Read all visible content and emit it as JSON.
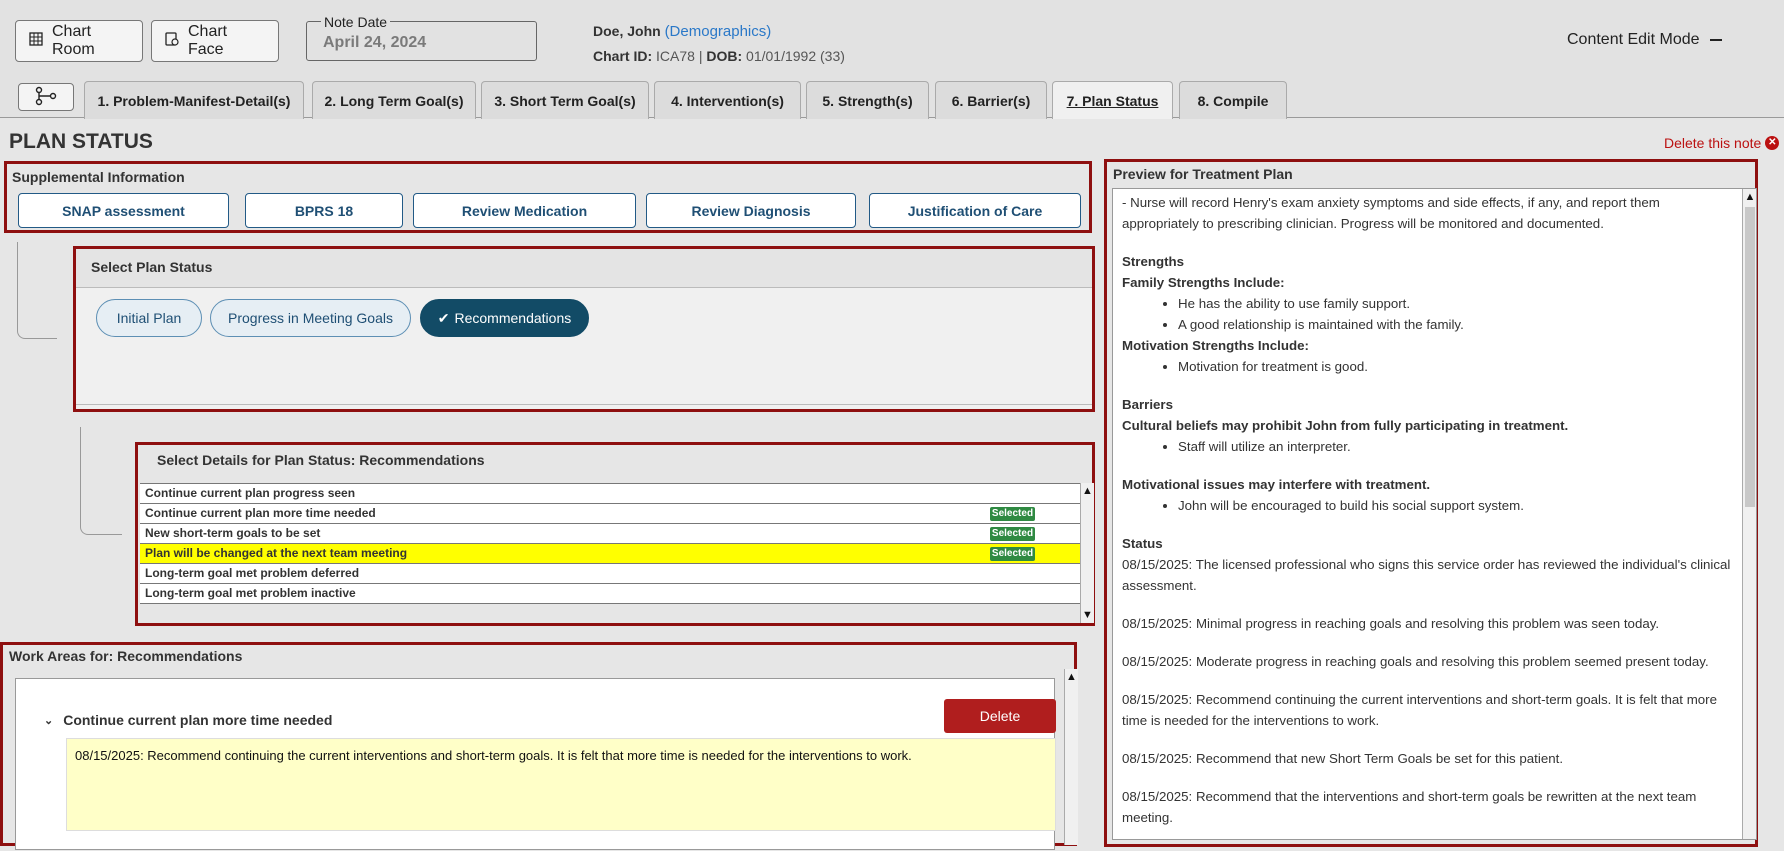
{
  "header": {
    "chart_room_label": "Chart Room",
    "chart_face_label": "Chart Face",
    "note_date_label": "Note Date",
    "note_date_value": "April 24, 2024",
    "patient_name": "Doe, John",
    "demographics_link": "(Demographics)",
    "chart_id_label": "Chart ID:",
    "chart_id_value": "ICA78",
    "separator": "|",
    "dob_label": "DOB:",
    "dob_value": "01/01/1992 (33)",
    "content_edit_mode": "Content Edit Mode"
  },
  "tabs": [
    {
      "label": "1. Problem-Manifest-Detail(s)"
    },
    {
      "label": "2. Long Term Goal(s)"
    },
    {
      "label": "3. Short Term Goal(s)"
    },
    {
      "label": "4. Intervention(s)"
    },
    {
      "label": "5. Strength(s)"
    },
    {
      "label": "6. Barrier(s)"
    },
    {
      "label": "7. Plan Status"
    },
    {
      "label": "8. Compile"
    }
  ],
  "page": {
    "title": "PLAN STATUS",
    "delete_note": "Delete this note"
  },
  "supplemental": {
    "title": "Supplemental Information",
    "buttons": [
      "SNAP assessment",
      "BPRS 18",
      "Review Medication",
      "Review Diagnosis",
      "Justification of Care"
    ]
  },
  "plan_status": {
    "title": "Select Plan Status",
    "options": [
      "Initial Plan",
      "Progress in Meeting Goals",
      "Recommendations"
    ],
    "selected_mark": "✔"
  },
  "details": {
    "title": "Select Details for Plan Status: Recommendations",
    "selected_badge": "Selected",
    "rows": [
      {
        "label": "Continue current plan progress seen",
        "selected": false
      },
      {
        "label": "Continue current plan more time needed",
        "selected": true
      },
      {
        "label": "New short-term goals to be set",
        "selected": true
      },
      {
        "label": "Plan will be changed at the next team meeting",
        "selected": true
      },
      {
        "label": "Long-term goal met problem deferred",
        "selected": false
      },
      {
        "label": "Long-term goal met problem inactive",
        "selected": false
      }
    ]
  },
  "work_areas": {
    "title": "Work Areas for: Recommendations",
    "item_title": "Continue current plan more time needed",
    "delete_label": "Delete",
    "text": "08/15/2025: Recommend continuing the current interventions and short-term goals. It is felt that more time is needed for the interventions to work."
  },
  "preview": {
    "title": "Preview for Treatment Plan",
    "intro": "-  Nurse will record Henry's exam anxiety symptoms and side effects, if any, and report them appropriately to prescribing clinician. Progress will be monitored and documented.",
    "strengths_heading": "Strengths",
    "family_heading": "Family Strengths Include:",
    "family_items": [
      "He has the ability to use family support.",
      "A good relationship is maintained with the family."
    ],
    "motivation_heading": "Motivation Strengths Include:",
    "motivation_items": [
      "Motivation for treatment is good."
    ],
    "barriers_heading": "Barriers",
    "barrier1_heading": "Cultural beliefs may prohibit John from fully participating in treatment.",
    "barrier1_items": [
      "Staff will utilize an interpreter."
    ],
    "barrier2_heading": "Motivational issues may interfere with treatment.",
    "barrier2_items": [
      "John will be encouraged to build his social support system."
    ],
    "status_heading": "Status",
    "status_items": [
      "08/15/2025: The licensed professional who signs this service order has reviewed the individual's clinical assessment.",
      "08/15/2025: Minimal progress in reaching goals and resolving this problem was seen today.",
      "08/15/2025: Moderate progress in reaching goals and resolving this problem seemed present today.",
      "08/15/2025: Recommend continuing the current interventions and short-term goals. It is felt that more time is needed for the interventions to work.",
      "08/15/2025: Recommend that new Short Term Goals be set for this patient.",
      "08/15/2025: Recommend that the interventions and short-term goals be rewritten at the next team meeting."
    ]
  },
  "colors": {
    "highlight_row": "#ffff00",
    "selected_badge": "#2f8a42",
    "delete_button": "#b01e1e",
    "active_pill": "#124b66",
    "frame_red": "#8e0f0f"
  }
}
